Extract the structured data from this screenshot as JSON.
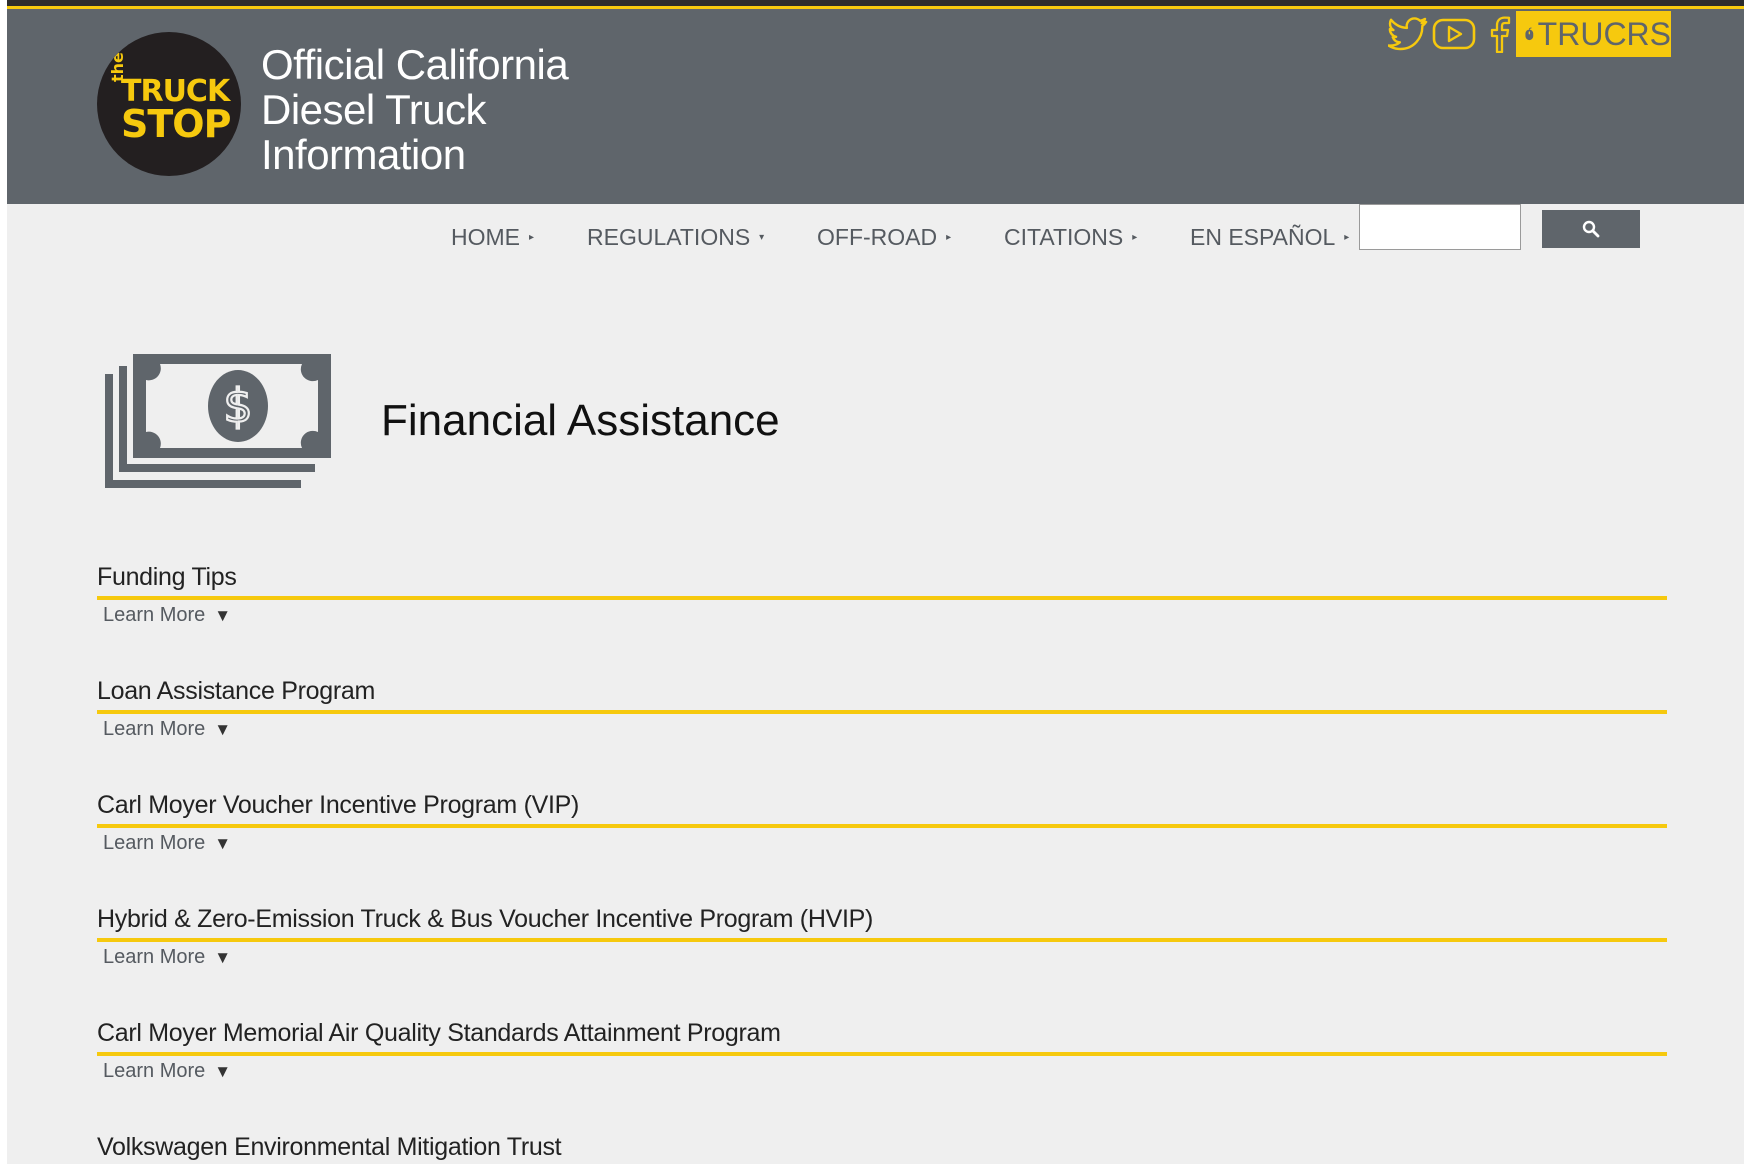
{
  "header": {
    "logo": {
      "the": "the",
      "truck": "TRUCK",
      "stop": "STOP"
    },
    "site_title_lines": [
      "Official California",
      "Diesel Truck",
      "Information"
    ],
    "social_icons": [
      "twitter-icon",
      "youtube-icon",
      "facebook-icon"
    ],
    "trucrs_label": "TRUCRS",
    "colors": {
      "bar": "#5f656b",
      "accent": "#f6c90e"
    }
  },
  "nav": {
    "items": [
      {
        "label": "HOME"
      },
      {
        "label": "REGULATIONS"
      },
      {
        "label": "OFF-ROAD"
      },
      {
        "label": "CITATIONS"
      },
      {
        "label": "EN ESPAÑOL"
      }
    ],
    "search": {
      "value": "",
      "button_icon": "search-icon"
    }
  },
  "main": {
    "title": "Financial Assistance",
    "icon": "money-icon",
    "learn_more_label": "Learn More",
    "items": [
      {
        "title": "Funding Tips"
      },
      {
        "title": "Loan Assistance Program"
      },
      {
        "title": "Carl Moyer Voucher Incentive Program (VIP)"
      },
      {
        "title": "Hybrid & Zero-Emission Truck & Bus Voucher Incentive Program (HVIP)"
      },
      {
        "title": "Carl Moyer Memorial Air Quality Standards Attainment Program"
      },
      {
        "title": "Volkswagen Environmental Mitigation Trust"
      }
    ]
  }
}
